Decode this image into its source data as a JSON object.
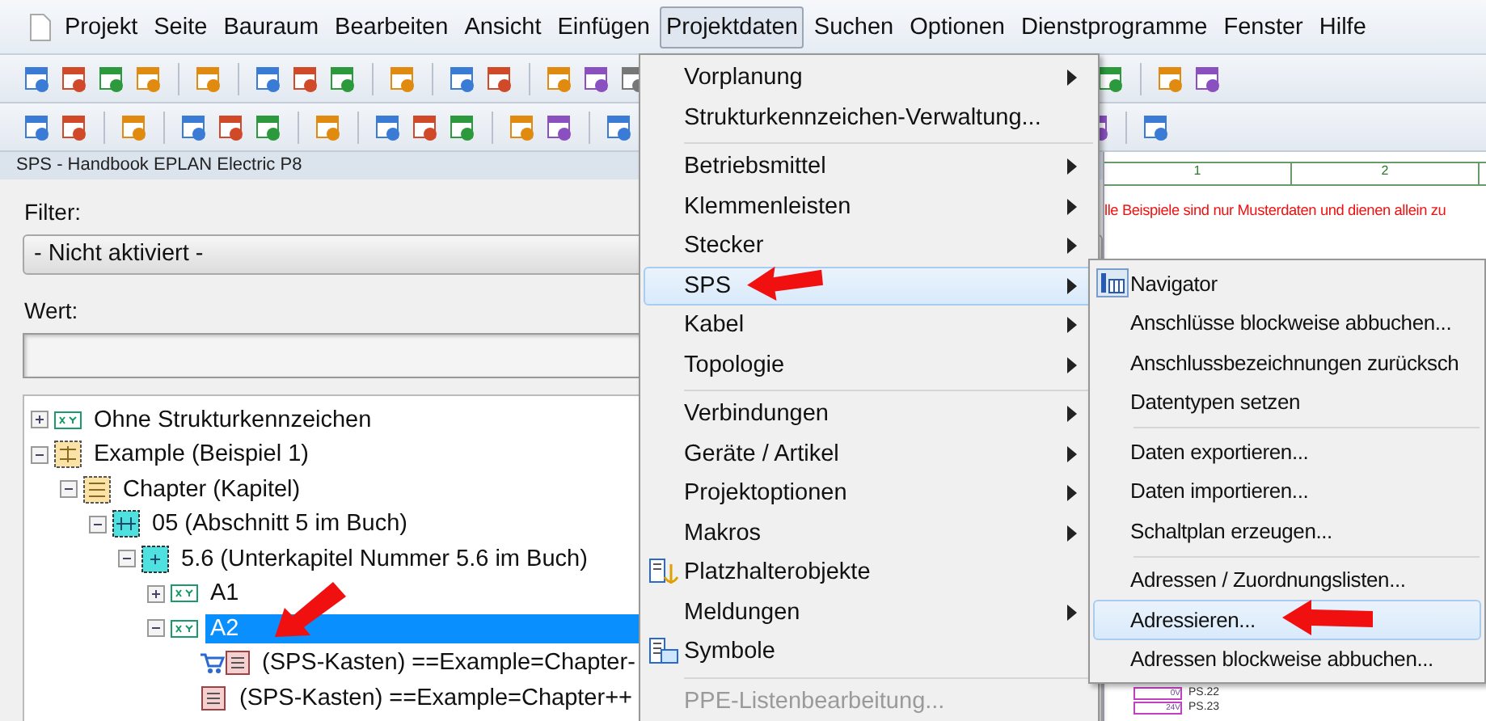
{
  "menu_bar": [
    {
      "label": "Projekt",
      "selected": false
    },
    {
      "label": "Seite",
      "selected": false
    },
    {
      "label": "Bauraum",
      "selected": false
    },
    {
      "label": "Bearbeiten",
      "selected": false
    },
    {
      "label": "Ansicht",
      "selected": false
    },
    {
      "label": "Einfügen",
      "selected": false
    },
    {
      "label": "Projektdaten",
      "selected": true
    },
    {
      "label": "Suchen",
      "selected": false
    },
    {
      "label": "Optionen",
      "selected": false
    },
    {
      "label": "Dienstprogramme",
      "selected": false
    },
    {
      "label": "Fenster",
      "selected": false
    },
    {
      "label": "Hilfe",
      "selected": false
    }
  ],
  "panel": {
    "title": "SPS - Handbook EPLAN Electric P8",
    "filter_label": "Filter:",
    "filter_value": "- Nicht aktiviert -",
    "value_label": "Wert:",
    "tree": [
      {
        "label": "Ohne Strukturkennzeichen",
        "kind": "xy",
        "expanded": false,
        "selected": false
      },
      {
        "label": "Example (Beispiel 1)",
        "kind": "grid",
        "expanded": true,
        "selected": false,
        "children": [
          {
            "label": "Chapter (Kapitel)",
            "kind": "lines",
            "expanded": true,
            "selected": false,
            "children": [
              {
                "label": "05 (Abschnitt 5 im Buch)",
                "kind": "section",
                "expanded": true,
                "selected": false,
                "children": [
                  {
                    "label": "5.6 (Unterkapitel Nummer 5.6 im Buch)",
                    "kind": "subsection",
                    "expanded": true,
                    "selected": false,
                    "children": [
                      {
                        "label": "A1",
                        "kind": "xy",
                        "expanded": false,
                        "selected": false
                      },
                      {
                        "label": "A2",
                        "kind": "xy",
                        "expanded": true,
                        "selected": true,
                        "children": [
                          {
                            "label": "(SPS-Kasten) ==Example=Chapter-",
                            "kind": "plc-cart",
                            "selected": false
                          },
                          {
                            "label": "(SPS-Kasten) ==Example=Chapter++",
                            "kind": "plc",
                            "selected": false
                          }
                        ]
                      }
                    ]
                  }
                ]
              }
            ]
          }
        ]
      }
    ]
  },
  "drawing": {
    "columns": [
      "1",
      "2"
    ],
    "notice": "lle Beispiele sind nur Musterdaten und dienen allein zu",
    "labels": [
      {
        "kind": "voltage",
        "text": "0V"
      },
      {
        "kind": "tag",
        "text": "PS.22"
      },
      {
        "kind": "voltage",
        "text": "24V"
      },
      {
        "kind": "tag",
        "text": "PS.23"
      }
    ]
  },
  "menu": [
    {
      "label": "Vorplanung",
      "submenu": true,
      "selected": false,
      "disabled": false
    },
    {
      "label": "Strukturkennzeichen-Verwaltung...",
      "submenu": false,
      "selected": false,
      "disabled": false
    },
    {
      "label": "Betriebsmittel",
      "submenu": true,
      "selected": false,
      "disabled": false,
      "separator_before": true
    },
    {
      "label": "Klemmenleisten",
      "submenu": true,
      "selected": false,
      "disabled": false
    },
    {
      "label": "Stecker",
      "submenu": true,
      "selected": false,
      "disabled": false
    },
    {
      "label": "SPS",
      "submenu": true,
      "selected": true,
      "disabled": false
    },
    {
      "label": "Kabel",
      "submenu": true,
      "selected": false,
      "disabled": false
    },
    {
      "label": "Topologie",
      "submenu": true,
      "selected": false,
      "disabled": false
    },
    {
      "label": "Verbindungen",
      "submenu": true,
      "selected": false,
      "disabled": false,
      "separator_before": true
    },
    {
      "label": "Geräte / Artikel",
      "submenu": true,
      "selected": false,
      "disabled": false
    },
    {
      "label": "Projektoptionen",
      "submenu": true,
      "selected": false,
      "disabled": false
    },
    {
      "label": "Makros",
      "submenu": true,
      "selected": false,
      "disabled": false
    },
    {
      "label": "Platzhalterobjekte",
      "submenu": false,
      "selected": false,
      "disabled": false
    },
    {
      "label": "Meldungen",
      "submenu": true,
      "selected": false,
      "disabled": false
    },
    {
      "label": "Symbole",
      "submenu": false,
      "selected": false,
      "disabled": false
    },
    {
      "label": "PPE-Listenbearbeitung...",
      "submenu": false,
      "selected": false,
      "disabled": true,
      "separator_before": true
    }
  ],
  "submenu": [
    {
      "label": "Navigator",
      "selected": false
    },
    {
      "label": "Anschlüsse blockweise abbuchen...",
      "selected": false
    },
    {
      "label": "Anschlussbezeichnungen zurücksch",
      "selected": false
    },
    {
      "label": "Datentypen setzen",
      "selected": false
    },
    {
      "label": "Daten exportieren...",
      "selected": false,
      "separator_before": true
    },
    {
      "label": "Daten importieren...",
      "selected": false
    },
    {
      "label": "Schaltplan erzeugen...",
      "selected": false
    },
    {
      "label": "Adressen / Zuordnungslisten...",
      "selected": false,
      "separator_before": true
    },
    {
      "label": "Adressieren...",
      "selected": true
    },
    {
      "label": "Adressen blockweise abbuchen...",
      "selected": false
    }
  ]
}
